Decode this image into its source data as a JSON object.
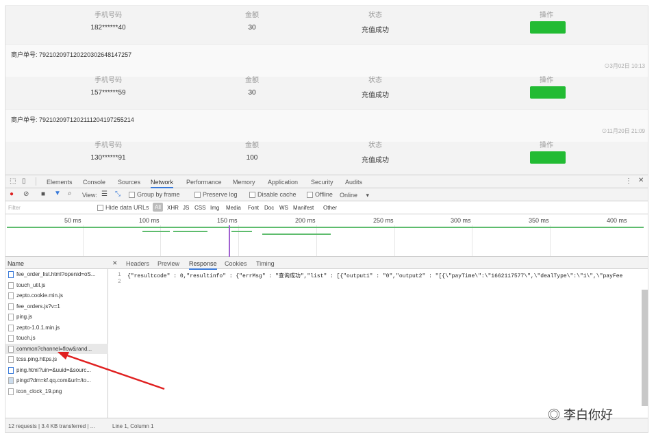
{
  "orders_top": {
    "headers": [
      "手机号码",
      "金额",
      "状态",
      "操作"
    ],
    "row": {
      "phone": "182******40",
      "amount": "30",
      "status": "充值成功"
    }
  },
  "orders": [
    {
      "order_no": "商户单号: 792102097120220302648147257",
      "time": "⊙3月02日 10:13",
      "phone": "157******59",
      "amount": "30",
      "status": "充值成功"
    },
    {
      "order_no": "商户单号: 792102097120211120419725521​4",
      "time": "⊙11月20日 21:09",
      "phone": "130******91",
      "amount": "100",
      "status": "充值成功"
    }
  ],
  "colors": {
    "accent": "#3879d9",
    "button": "#22bb33",
    "record": "#d22"
  },
  "devtools": {
    "tabs": [
      "Elements",
      "Console",
      "Sources",
      "Network",
      "Performance",
      "Memory",
      "Application",
      "Security",
      "Audits"
    ],
    "active_tab": "Network",
    "toolbar": {
      "view": "View:",
      "group_by_frame": "Group by frame",
      "preserve_log": "Preserve log",
      "disable_cache": "Disable cache",
      "offline": "Offline",
      "online": "Online"
    },
    "filter": {
      "placeholder": "Filter",
      "hide_data_urls": "Hide data URLs",
      "types": [
        "All",
        "XHR",
        "JS",
        "CSS",
        "Img",
        "Media",
        "Font",
        "Doc",
        "WS",
        "Manifest",
        "Other"
      ]
    },
    "timeline_ticks": [
      "50 ms",
      "100 ms",
      "150 ms",
      "200 ms",
      "250 ms",
      "300 ms",
      "350 ms",
      "400 ms"
    ],
    "name_header": "Name",
    "files": [
      "fee_order_list.html?openid=oS...",
      "touch_util.js",
      "zepto.cookie.min.js",
      "fee_orders.js?v=1",
      "ping.js",
      "zepto-1.0.1.min.js",
      "touch.js",
      "common?channel=flow&rand...",
      "tcss.ping.https.js",
      "ping.html?uin=&uuid=&sourc...",
      "pingd?dm=kf.qq.com&url=/to...",
      "icon_clock_19.png"
    ],
    "response_tabs": [
      "Headers",
      "Preview",
      "Response",
      "Cookies",
      "Timing"
    ],
    "active_response_tab": "Response",
    "code_lines": [
      "{\"resultcode\" : 0,\"resultinfo\" : {\"errMsg\" : \"查询成功\",\"list\" : [{\"output1\" : \"0\",\"output2\" : \"[{\\\"payTime\\\":\\\"1662117577\\\",\\\"dealType\\\":\\\"1\\\",\\\"payFee",
      ""
    ],
    "status_left": "12 requests | 3.4 KB transferred | ...",
    "status_right": "Line 1, Column 1"
  },
  "watermark": "李白你好"
}
